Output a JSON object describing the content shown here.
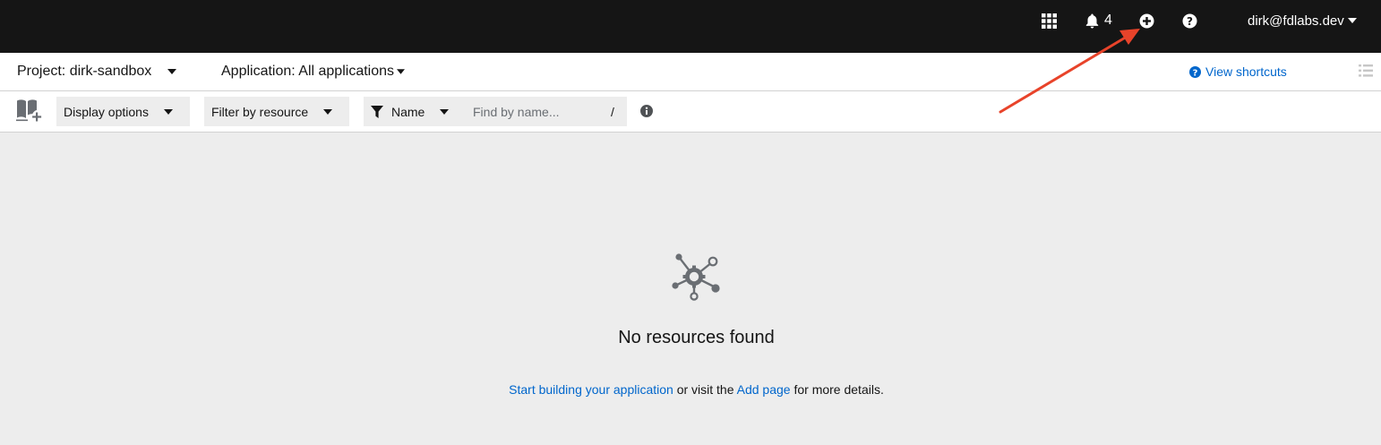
{
  "masthead": {
    "notification_count": "4",
    "user": "dirk@fdlabs.dev"
  },
  "project_bar": {
    "project": "Project: dirk-sandbox",
    "application": "Application: All applications",
    "view_shortcuts": "View shortcuts"
  },
  "toolbar": {
    "display_options": "Display options",
    "filter_by_resource": "Filter by resource",
    "filter_type": "Name",
    "search_placeholder": "Find by name...",
    "search_shortcut": "/"
  },
  "empty_state": {
    "title": "No resources found",
    "link_start": "Start building your application",
    "text_middle": " or visit the ",
    "link_add": "Add page",
    "text_end": " for more details."
  },
  "colors": {
    "masthead": "#151515",
    "link": "#0066cc",
    "annotation_arrow": "#e8432a"
  }
}
